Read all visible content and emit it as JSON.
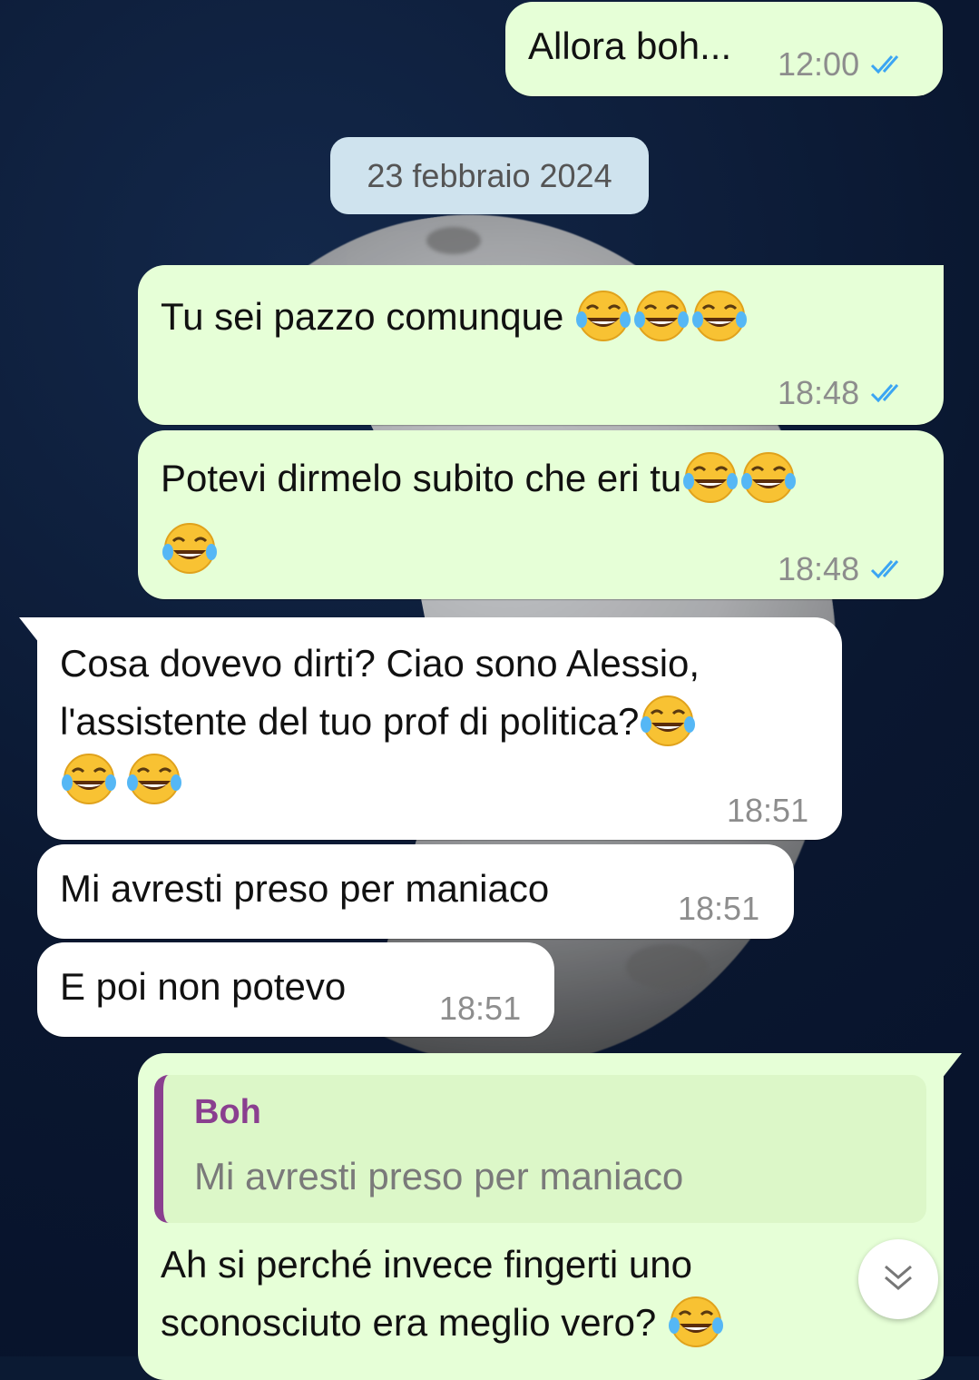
{
  "date_separator": "23 febbraio 2024",
  "messages": [
    {
      "text": "Allora boh...",
      "time": "12:00"
    },
    {
      "text": "Tu sei pazzo comunque ",
      "time": "18:48"
    },
    {
      "text": "Potevi dirmelo subito che eri tu",
      "time": "18:48"
    },
    {
      "line1": "Cosa dovevo dirti? Ciao sono Alessio,",
      "line2": "l'assistente del tuo prof di politica?",
      "time": "18:51"
    },
    {
      "text": "Mi avresti preso per maniaco",
      "time": "18:51"
    },
    {
      "text": "E poi non potevo",
      "time": "18:51"
    },
    {
      "reply_author": "Boh",
      "reply_text": "Mi avresti preso per maniaco",
      "line1": "Ah si perché invece fingerti uno",
      "line2": "sconosciuto era meglio vero? "
    }
  ],
  "icons": {
    "emoji": "face-with-tears-of-joy-icon",
    "read_receipt": "double-check-icon",
    "scroll": "chevron-double-down-icon"
  },
  "colors": {
    "outgoing_bubble": "#e6ffd7",
    "incoming_bubble": "#ffffff",
    "read_ticks": "#3ba5f3",
    "reply_accent": "#8a3f8f"
  }
}
